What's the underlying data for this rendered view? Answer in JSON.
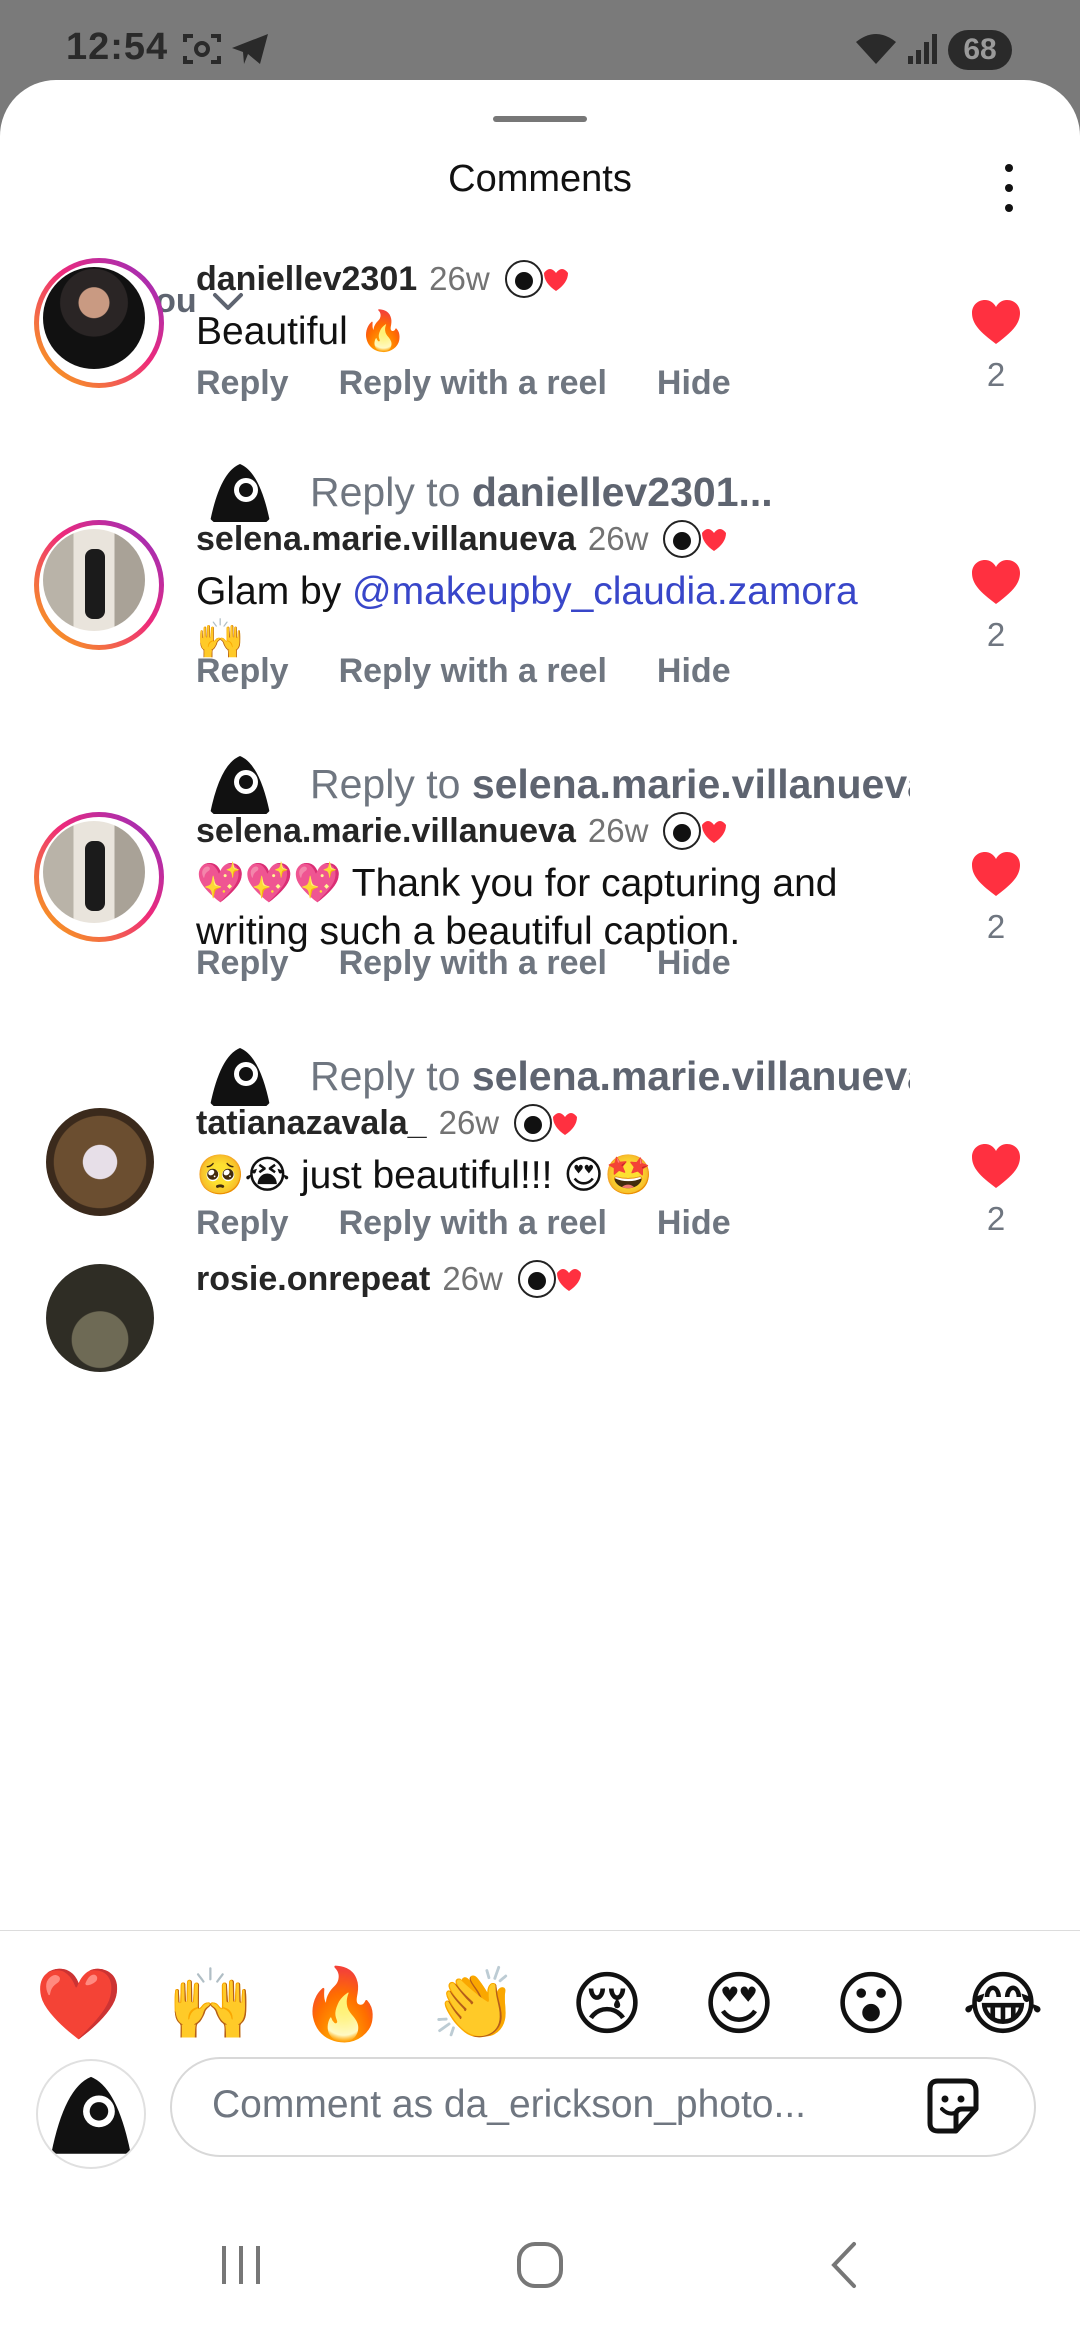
{
  "status": {
    "time": "12:54",
    "battery": "68"
  },
  "sheet": {
    "title": "Comments",
    "filter_label": "For you"
  },
  "comments": [
    {
      "username": "daniellev2301",
      "age": "26w",
      "text": "Beautiful 🔥",
      "mention": "",
      "likes": "2",
      "reply_prompt_prefix": "Reply to ",
      "reply_prompt_user": "daniellev2301..."
    },
    {
      "username": "selena.marie.villanueva",
      "age": "26w",
      "text": "Glam by ",
      "mention": "@makeupby_claudia.zamora",
      "text_after": "🙌",
      "likes": "2",
      "reply_prompt_prefix": "Reply to ",
      "reply_prompt_user": "selena.marie.villanueva"
    },
    {
      "username": "selena.marie.villanueva",
      "age": "26w",
      "text": "💖💖💖 Thank you for capturing and writing such a beautiful caption.",
      "mention": "",
      "likes": "2",
      "reply_prompt_prefix": "Reply to ",
      "reply_prompt_user": "selena.marie.villanueva"
    },
    {
      "username": "tatianazavala_",
      "age": "26w",
      "text": "🥺😭 just beautiful!!! 😍🤩",
      "mention": "",
      "likes": "2"
    },
    {
      "username": "rosie.onrepeat",
      "age": "26w"
    }
  ],
  "actions": {
    "reply": "Reply",
    "reply_reel": "Reply with a reel",
    "hide": "Hide"
  },
  "quick_emojis": [
    "❤️",
    "🙌",
    "🔥",
    "👏",
    "😢",
    "😍",
    "😮",
    "😂"
  ],
  "composer": {
    "placeholder": "Comment as da_erickson_photo..."
  },
  "colors": {
    "like_red": "#ff3040",
    "mention_blue": "#3846c9",
    "story_ring_start": "#f9b10c",
    "story_ring_end": "#8a2fc7"
  }
}
